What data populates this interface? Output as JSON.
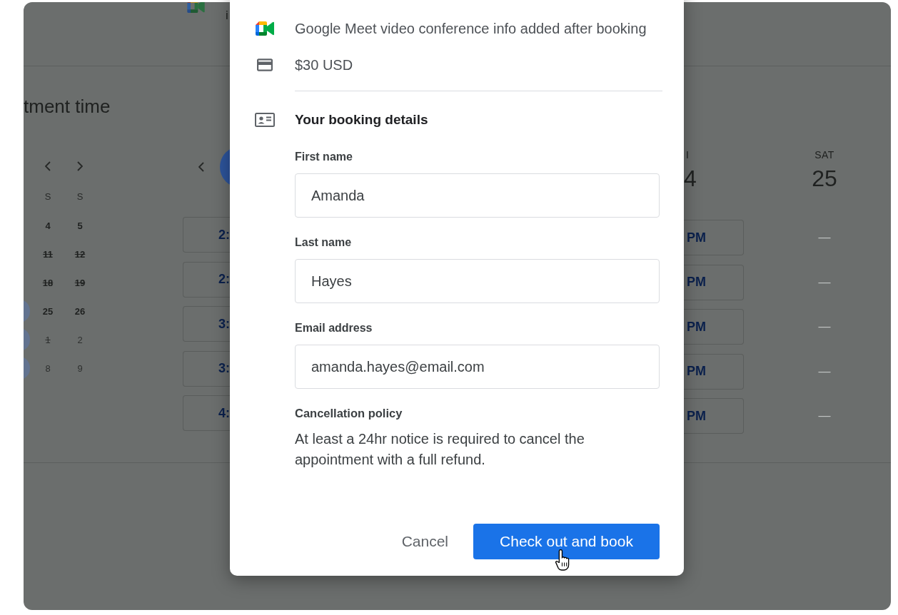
{
  "background": {
    "header_text": "i",
    "title": "tment time",
    "mini_calendar": {
      "weekdays": [
        "S",
        "S"
      ],
      "weeks": [
        {
          "edge_marker": false,
          "days": [
            {
              "label": "4",
              "struck": false,
              "muted": false
            },
            {
              "label": "5",
              "struck": false,
              "muted": false
            }
          ]
        },
        {
          "edge_marker": false,
          "days": [
            {
              "label": "11",
              "struck": true,
              "muted": false
            },
            {
              "label": "12",
              "struck": true,
              "muted": false
            }
          ]
        },
        {
          "edge_marker": false,
          "days": [
            {
              "label": "18",
              "struck": true,
              "muted": false
            },
            {
              "label": "19",
              "struck": true,
              "muted": false
            }
          ]
        },
        {
          "edge_marker": true,
          "days": [
            {
              "label": "25",
              "struck": false,
              "muted": false
            },
            {
              "label": "26",
              "struck": false,
              "muted": false
            }
          ]
        },
        {
          "edge_marker": true,
          "days": [
            {
              "label": "1",
              "struck": true,
              "muted": true
            },
            {
              "label": "2",
              "struck": false,
              "muted": true
            }
          ]
        },
        {
          "edge_marker": true,
          "days": [
            {
              "label": "8",
              "struck": false,
              "muted": true
            },
            {
              "label": "9",
              "struck": false,
              "muted": true
            }
          ]
        }
      ]
    },
    "week": {
      "left_slots": [
        "2:",
        "2:",
        "3:",
        "3:",
        "4:"
      ],
      "columns": [
        {
          "kind": "slots",
          "name": "I",
          "date": "4",
          "slots": [
            "PM",
            "PM",
            "PM",
            "PM",
            "PM"
          ]
        },
        {
          "kind": "dashes",
          "name": "SAT",
          "date": "25",
          "slots": [
            "—",
            "—",
            "—",
            "—",
            "—"
          ]
        }
      ]
    }
  },
  "dialog": {
    "info": [
      {
        "kind": "meet",
        "text": "Google Meet video conference info added after booking"
      },
      {
        "kind": "payment",
        "text": "$30 USD"
      }
    ],
    "section_title": "Your booking details",
    "fields": [
      {
        "label": "First name",
        "value": "Amanda"
      },
      {
        "label": "Last name",
        "value": "Hayes"
      },
      {
        "label": "Email address",
        "value": "amanda.hayes@email.com"
      }
    ],
    "policy": {
      "title": "Cancellation policy",
      "text": "At least a 24hr notice is required to cancel the appointment with a full refund."
    },
    "buttons": [
      {
        "kind": "text",
        "label": "Cancel"
      },
      {
        "kind": "primary",
        "label": "Check out and book"
      }
    ]
  }
}
